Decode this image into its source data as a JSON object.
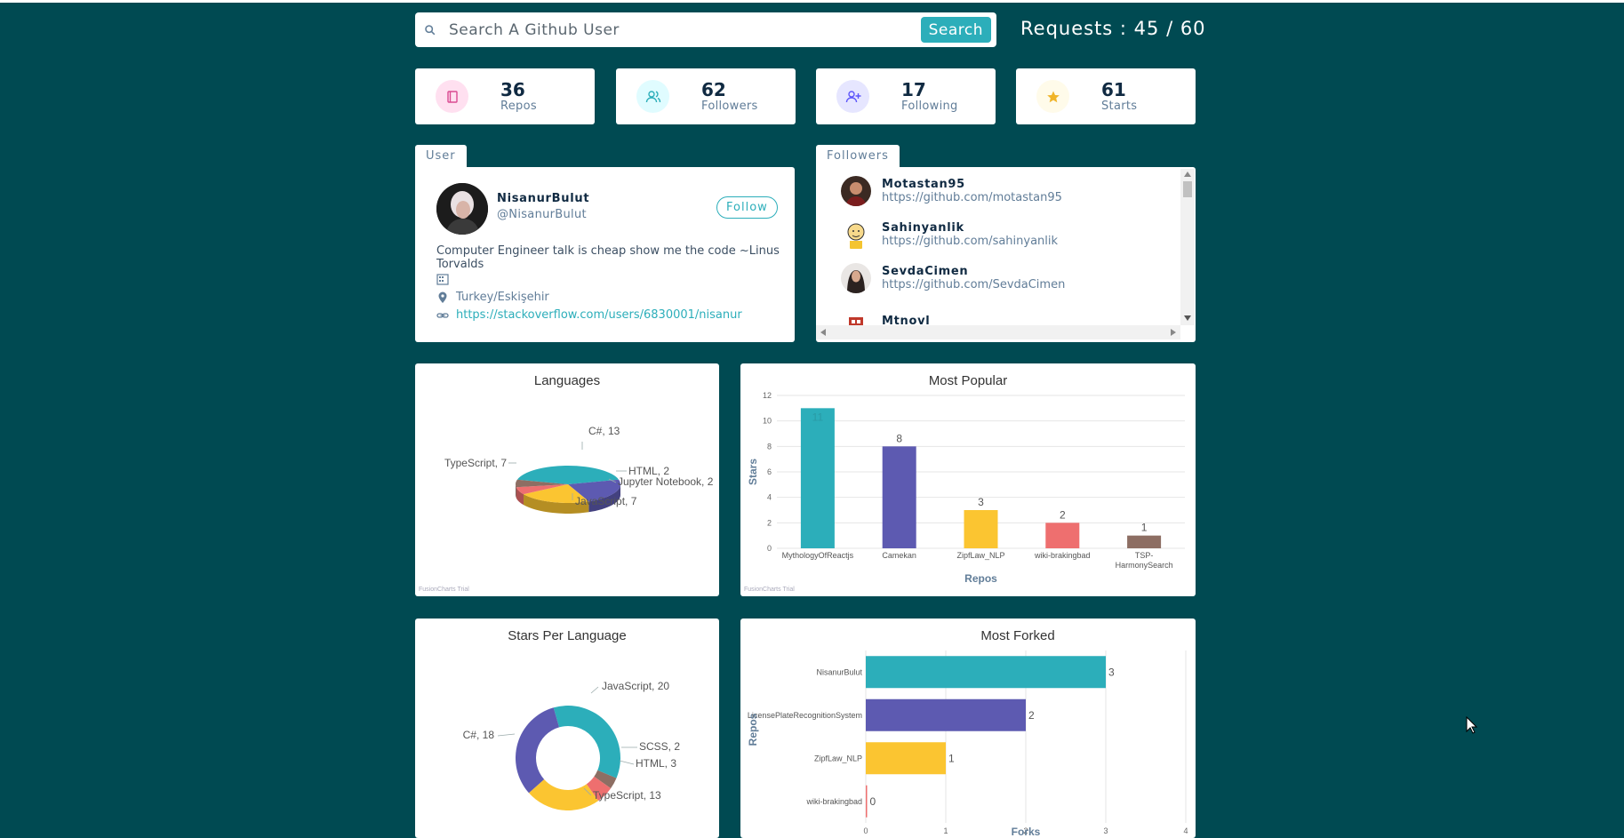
{
  "search": {
    "placeholder": "Search A Github User",
    "button_label": "Search"
  },
  "requests": "Requests : 45 / 60",
  "stats": [
    {
      "value": "36",
      "label": "Repos",
      "icon": "book-icon",
      "color": "#da4a91",
      "bg": "#ffe0f0"
    },
    {
      "value": "62",
      "label": "Followers",
      "icon": "users-icon",
      "color": "#2caeba",
      "bg": "#e0fcff"
    },
    {
      "value": "17",
      "label": "Following",
      "icon": "user-plus-icon",
      "color": "#5d55fa",
      "bg": "#e6e6ff"
    },
    {
      "value": "61",
      "label": "Starts",
      "icon": "star-icon",
      "color": "#f0b429",
      "bg": "#fffbea"
    }
  ],
  "user_card": {
    "tab": "User",
    "name": "NisanurBulut",
    "handle": "@NisanurBulut",
    "follow_label": "Follow",
    "bio": "Computer Engineer talk is cheap show me the code ~Linus Torvalds",
    "company": "",
    "location": "Turkey/Eskişehir",
    "blog": "https://stackoverflow.com/users/6830001/nisanur"
  },
  "followers_card": {
    "tab": "Followers",
    "items": [
      {
        "name": "Motastan95",
        "url": "https://github.com/motastan95"
      },
      {
        "name": "Sahinyanlik",
        "url": "https://github.com/sahinyanlik"
      },
      {
        "name": "SevdaCimen",
        "url": "https://github.com/SevdaCimen"
      },
      {
        "name": "Mtnovl",
        "url": ""
      }
    ]
  },
  "trial_text": "FusionCharts Trial",
  "chart_data": [
    {
      "type": "pie",
      "title": "Languages",
      "categories": [
        "C#",
        "TypeScript",
        "JavaScript",
        "HTML",
        "Jupyter Notebook"
      ],
      "values": [
        13,
        7,
        7,
        2,
        2
      ],
      "labels": [
        "C#, 13",
        "TypeScript, 7",
        "JavaScript, 7",
        "HTML, 2",
        "Jupyter Notebook, 2"
      ],
      "colors": [
        "#2caeba",
        "#5d5ab1",
        "#fbc531",
        "#ee6f6f",
        "#8d6e63"
      ]
    },
    {
      "type": "bar",
      "title": "Most Popular",
      "xlabel": "Repos",
      "ylabel": "Stars",
      "categories": [
        "MythologyOfReactjs",
        "Camekan",
        "ZipfLaw_NLP",
        "wiki-brakingbad",
        "TSP-HarmonySearch"
      ],
      "category_lines": [
        [
          "MythologyOfReactjs"
        ],
        [
          "Camekan"
        ],
        [
          "ZipfLaw_NLP"
        ],
        [
          "wiki-brakingbad"
        ],
        [
          "TSP-",
          "HarmonySearch"
        ]
      ],
      "values": [
        11,
        8,
        3,
        2,
        1
      ],
      "value_labels": [
        "11",
        "8",
        "3",
        "2",
        "1"
      ],
      "ylim": [
        0,
        12
      ],
      "yticks": [
        "0",
        "2",
        "4",
        "6",
        "8",
        "10",
        "12"
      ],
      "colors": [
        "#2caeba",
        "#5d5ab1",
        "#fbc531",
        "#ee6f6f",
        "#8d6e63"
      ]
    },
    {
      "type": "pie",
      "title": "Stars Per Language",
      "categories": [
        "JavaScript",
        "C#",
        "TypeScript",
        "HTML",
        "SCSS"
      ],
      "values": [
        20,
        18,
        13,
        3,
        2
      ],
      "labels": [
        "JavaScript, 20",
        "C#, 18",
        "TypeScript, 13",
        "HTML, 3",
        "SCSS, 2"
      ],
      "colors": [
        "#2caeba",
        "#5d5ab1",
        "#fbc531",
        "#ee6f6f",
        "#8d6e63"
      ]
    },
    {
      "type": "bar",
      "orientation": "horizontal",
      "title": "Most Forked",
      "xlabel": "Forks",
      "ylabel": "Repos",
      "categories": [
        "NisanurBulut",
        "LicensePlateRecognitionSystem",
        "ZipfLaw_NLP",
        "wiki-brakingbad"
      ],
      "values": [
        3,
        2,
        1,
        0
      ],
      "value_labels": [
        "3",
        "2",
        "1",
        "0"
      ],
      "xlim": [
        0,
        4
      ],
      "xticks": [
        "0",
        "1",
        "2",
        "3",
        "4"
      ],
      "colors": [
        "#2caeba",
        "#5d5ab1",
        "#fbc531",
        "#ee6f6f"
      ]
    }
  ]
}
